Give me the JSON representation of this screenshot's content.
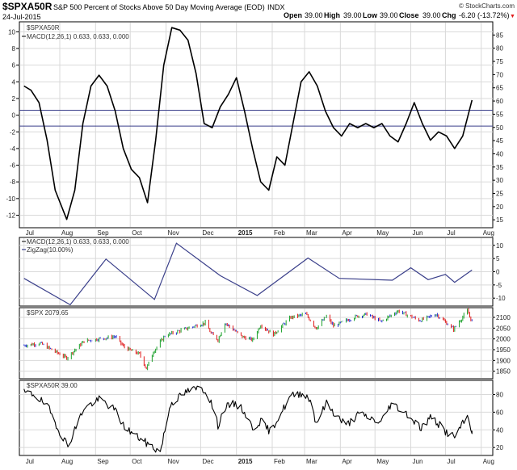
{
  "header": {
    "symbol": "$SPXA50R",
    "description": "S&P 500 Percent of Stocks Above 50 Day Moving Average (EOD)",
    "exchange": "INDX",
    "copyright": "© StockCharts.com",
    "date": "24-Jul-2015",
    "open_label": "Open",
    "open_value": "39.00",
    "high_label": "High",
    "high_value": "39.00",
    "low_label": "Low",
    "low_value": "39.00",
    "close_label": "Close",
    "close_value": "39.00",
    "chg_label": "Chg",
    "chg_value": "-6.20 (-13.72%)",
    "chg_marker": "▼"
  },
  "colors": {
    "background": "#ffffff",
    "frame": "#000000",
    "grid": "#d9d9d9",
    "hline": "#3a3f8a",
    "zigzag": "#3a3f8a",
    "up_bar": "#1aa02a",
    "down_bar": "#e01818",
    "neutral_bar": "#1f2ad0",
    "price_line": "#000000"
  },
  "x_axis": {
    "months": [
      "Jul",
      "Aug",
      "Sep",
      "Oct",
      "Nov",
      "Dec",
      "2015",
      "Feb",
      "Mar",
      "Apr",
      "May",
      "Jun",
      "Jul",
      "Aug"
    ],
    "bold": [
      false,
      false,
      false,
      false,
      false,
      false,
      true,
      false,
      false,
      false,
      false,
      false,
      false,
      false
    ]
  },
  "chart_data": [
    {
      "type": "line",
      "panel": "main",
      "legend": [
        "$SPXA50R",
        "MACD(12,26,1) 0.633, 0.633, 0.000"
      ],
      "y_left": {
        "ticks": [
          10,
          8,
          6,
          4,
          2,
          0,
          -2,
          -4,
          -6,
          -8,
          -10,
          -12
        ],
        "range": [
          -13.5,
          11.2
        ],
        "label": "MACD"
      },
      "y_right": {
        "ticks": [
          85,
          80,
          75,
          70,
          65,
          60,
          55,
          50,
          45,
          40,
          35,
          30,
          25,
          20,
          15
        ],
        "range": [
          12,
          90
        ]
      },
      "reference_lines_right_scale": [
        56.5,
        50.5
      ],
      "x": [
        "2014-07-01",
        "2014-07-07",
        "2014-07-14",
        "2014-07-21",
        "2014-07-28",
        "2014-08-07",
        "2014-08-14",
        "2014-08-21",
        "2014-08-28",
        "2014-09-04",
        "2014-09-11",
        "2014-09-18",
        "2014-09-25",
        "2014-10-02",
        "2014-10-09",
        "2014-10-16",
        "2014-10-23",
        "2014-10-30",
        "2014-11-06",
        "2014-11-13",
        "2014-11-20",
        "2014-11-27",
        "2014-12-04",
        "2014-12-11",
        "2014-12-18",
        "2014-12-25",
        "2015-01-01",
        "2015-01-08",
        "2015-01-15",
        "2015-01-22",
        "2015-01-29",
        "2015-02-05",
        "2015-02-12",
        "2015-02-19",
        "2015-02-26",
        "2015-03-05",
        "2015-03-12",
        "2015-03-19",
        "2015-03-26",
        "2015-04-02",
        "2015-04-09",
        "2015-04-16",
        "2015-04-23",
        "2015-04-30",
        "2015-05-07",
        "2015-05-14",
        "2015-05-21",
        "2015-05-28",
        "2015-06-04",
        "2015-06-11",
        "2015-06-18",
        "2015-06-25",
        "2015-07-02",
        "2015-07-09",
        "2015-07-16",
        "2015-07-24"
      ],
      "values": [
        3.5,
        3.0,
        1.5,
        -3.0,
        -9.0,
        -12.5,
        -9.0,
        -1.0,
        3.5,
        4.8,
        3.5,
        0.5,
        -4.0,
        -6.5,
        -7.5,
        -10.5,
        -3.0,
        6.0,
        10.5,
        10.2,
        9.0,
        5.0,
        -1.0,
        -1.5,
        1.0,
        2.5,
        4.5,
        0.5,
        -4.0,
        -8.0,
        -9.0,
        -5.0,
        -6.0,
        -1.0,
        4.0,
        5.2,
        3.5,
        0.5,
        -1.5,
        -2.5,
        -1.0,
        -1.5,
        -1.0,
        -1.5,
        -1.0,
        -2.5,
        -3.2,
        -1.0,
        1.5,
        -1.0,
        -3.0,
        -2.0,
        -2.5,
        -4.0,
        -2.5,
        1.8,
        0.633
      ]
    },
    {
      "type": "line",
      "panel": "macd_zigzag",
      "legend": [
        "MACD(12,26,1) 0.633, 0.633, 0.000",
        "ZigZag(10.00%)"
      ],
      "y_right": {
        "ticks": [
          10,
          5,
          0,
          -5,
          -10
        ],
        "range": [
          -13,
          13
        ]
      },
      "x": [
        "2014-07-01",
        "2014-08-10",
        "2014-09-10",
        "2014-10-22",
        "2014-11-10",
        "2014-12-18",
        "2015-01-19",
        "2015-03-04",
        "2015-03-31",
        "2015-05-16",
        "2015-06-01",
        "2015-06-16",
        "2015-07-01",
        "2015-07-09",
        "2015-07-24"
      ],
      "values": [
        -2.5,
        -12.5,
        4.8,
        -10.5,
        10.8,
        -1.5,
        -9.0,
        5.2,
        -2.5,
        -3.2,
        1.5,
        -3.0,
        -1.0,
        -4.0,
        0.633
      ]
    },
    {
      "type": "bar",
      "panel": "spx",
      "legend": [
        "$SPX 2079.65"
      ],
      "y_right": {
        "ticks": [
          2100,
          2050,
          2000,
          1950,
          1900,
          1850
        ],
        "range": [
          1815,
          2145
        ]
      },
      "x": [
        "2014-07-01",
        "2014-07-15",
        "2014-07-31",
        "2014-08-07",
        "2014-08-22",
        "2014-09-18",
        "2014-09-25",
        "2014-10-01",
        "2014-10-09",
        "2014-10-15",
        "2014-10-21",
        "2014-10-31",
        "2014-11-14",
        "2014-12-05",
        "2014-12-10",
        "2014-12-16",
        "2014-12-22",
        "2015-01-06",
        "2015-01-15",
        "2015-01-22",
        "2015-02-02",
        "2015-02-17",
        "2015-03-02",
        "2015-03-11",
        "2015-03-20",
        "2015-03-26",
        "2015-04-15",
        "2015-04-24",
        "2015-05-06",
        "2015-05-21",
        "2015-06-09",
        "2015-06-23",
        "2015-07-08",
        "2015-07-20",
        "2015-07-24"
      ],
      "values": [
        1970,
        1980,
        1932,
        1912,
        1990,
        2011,
        1966,
        1947,
        1930,
        1862,
        1940,
        2015,
        2040,
        2075,
        2025,
        1995,
        2075,
        2010,
        1995,
        2065,
        2020,
        2100,
        2115,
        2050,
        2105,
        2060,
        2105,
        2115,
        2080,
        2130,
        2085,
        2115,
        2045,
        2130,
        2079.65
      ]
    },
    {
      "type": "line",
      "panel": "spxa50r_price",
      "legend": [
        "$SPXA50R 39.00"
      ],
      "y_right": {
        "ticks": [
          80,
          60,
          40,
          20
        ],
        "range": [
          11,
          96
        ]
      },
      "x": [
        "2014-07-01",
        "2014-07-10",
        "2014-07-22",
        "2014-08-01",
        "2014-08-08",
        "2014-08-22",
        "2014-09-05",
        "2014-09-18",
        "2014-09-25",
        "2014-10-01",
        "2014-10-15",
        "2014-10-27",
        "2014-11-05",
        "2014-11-20",
        "2014-12-02",
        "2014-12-09",
        "2014-12-16",
        "2014-12-22",
        "2014-12-31",
        "2015-01-07",
        "2015-01-15",
        "2015-01-22",
        "2015-01-30",
        "2015-02-09",
        "2015-02-17",
        "2015-02-27",
        "2015-03-06",
        "2015-03-11",
        "2015-03-20",
        "2015-03-26",
        "2015-04-06",
        "2015-04-17",
        "2015-04-24",
        "2015-05-06",
        "2015-05-15",
        "2015-05-21",
        "2015-05-29",
        "2015-06-10",
        "2015-06-19",
        "2015-07-01",
        "2015-07-09",
        "2015-07-20",
        "2015-07-24"
      ],
      "values": [
        82,
        80,
        65,
        38,
        22,
        65,
        75,
        62,
        45,
        38,
        25,
        15,
        70,
        84,
        88,
        75,
        45,
        65,
        70,
        62,
        42,
        50,
        38,
        60,
        78,
        82,
        74,
        48,
        70,
        60,
        45,
        58,
        55,
        48,
        70,
        65,
        58,
        42,
        55,
        38,
        32,
        55,
        39
      ]
    }
  ]
}
